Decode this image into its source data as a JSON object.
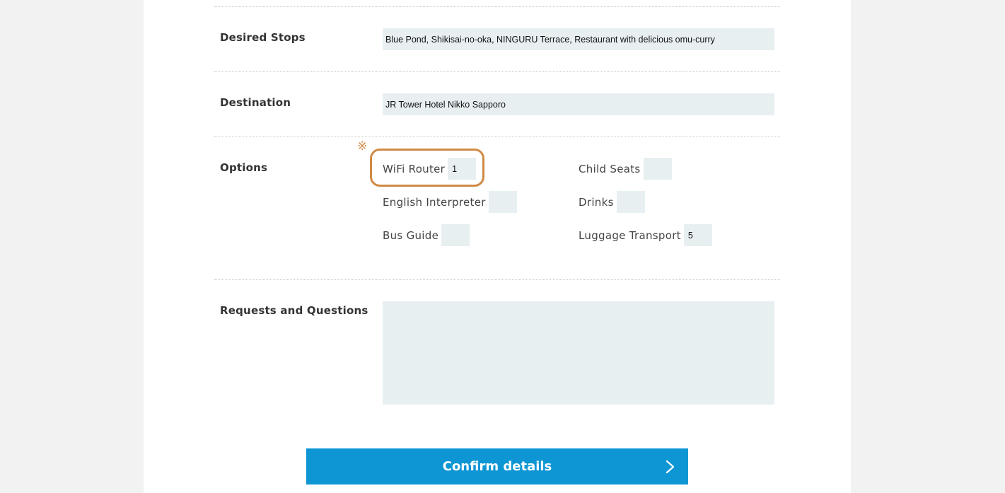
{
  "form": {
    "desired_stops": {
      "label": "Desired Stops",
      "value": "Blue Pond, Shikisai-no-oka, NINGURU Terrace, Restaurant with delicious omu-curry"
    },
    "destination": {
      "label": "Destination",
      "value": "JR Tower Hotel Nikko Sapporo"
    },
    "options": {
      "label": "Options",
      "mark": "※",
      "items": [
        {
          "label": "WiFi Router",
          "value": "1"
        },
        {
          "label": "Child Seats",
          "value": ""
        },
        {
          "label": "English Interpreter",
          "value": ""
        },
        {
          "label": "Drinks",
          "value": ""
        },
        {
          "label": "Bus Guide",
          "value": ""
        },
        {
          "label": "Luggage Transport",
          "value": "5"
        }
      ]
    },
    "requests": {
      "label": "Requests and Questions",
      "value": ""
    },
    "confirm_label": "Confirm details"
  },
  "colors": {
    "accent_blue": "#0e96d4",
    "highlight_orange": "#d08a45",
    "field_bg": "#e7eff1"
  },
  "icons": {
    "confirm": "chevron-right-icon"
  }
}
